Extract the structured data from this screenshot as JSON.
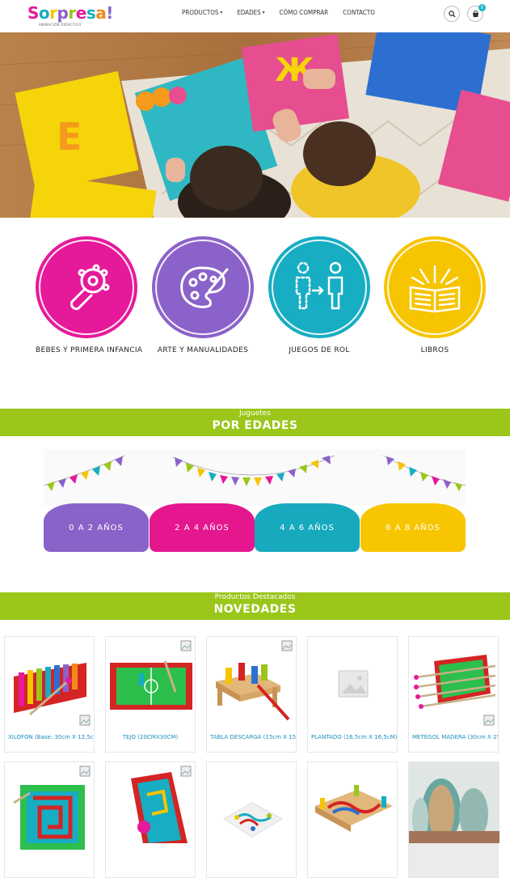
{
  "header": {
    "logo_text": "Sorpresa!",
    "logo_tagline": "ANIMACIÓN DIDÁCTICO",
    "nav": [
      {
        "label": "PRODUCTOS",
        "has_dropdown": true
      },
      {
        "label": "EDADES",
        "has_dropdown": true
      },
      {
        "label": "CÓMO COMPRAR",
        "has_dropdown": false
      },
      {
        "label": "CONTACTO",
        "has_dropdown": false
      }
    ],
    "cart_count": "0"
  },
  "categories": [
    {
      "label": "BEBES Y PRIMERA INFANCIA",
      "color": "#e6199a",
      "icon": "rattle-icon"
    },
    {
      "label": "ARTE Y MANUALIDADES",
      "color": "#8b62c9",
      "icon": "palette-icon"
    },
    {
      "label": "JUEGOS DE ROL",
      "color": "#17adc3",
      "icon": "role-play-icon"
    },
    {
      "label": "LIBROS",
      "color": "#f7c400",
      "icon": "book-icon"
    }
  ],
  "ages_section": {
    "small": "Juguetes",
    "big": "POR EDADES"
  },
  "age_tabs": [
    {
      "label": "0 A 2 AÑOS",
      "color": "#8a63c8"
    },
    {
      "label": "2 A 4 AÑOS",
      "color": "#e4178f"
    },
    {
      "label": "4 A 6 AÑOS",
      "color": "#17a9bd"
    },
    {
      "label": "6 A 8 AÑOS",
      "color": "#f8c600"
    }
  ],
  "featured_section": {
    "small": "Productos Destacados",
    "big": "NOVEDADES"
  },
  "products": [
    {
      "name": "XILOFÓN (Base: 30cm X 12,5c..."
    },
    {
      "name": "TEJO (20CMX30CM)"
    },
    {
      "name": "TABLA DESCARGA (15cm X 15c..."
    },
    {
      "name": "PLANTADO (16,5cm X 16,5cM)-"
    },
    {
      "name": "METEGOL MADERA (30cm X 25..."
    },
    {
      "name": ""
    },
    {
      "name": ""
    },
    {
      "name": ""
    },
    {
      "name": ""
    },
    {
      "name": ""
    }
  ],
  "colors": {
    "brand_green": "#9bc61a",
    "link_blue": "#1a8fc0"
  }
}
